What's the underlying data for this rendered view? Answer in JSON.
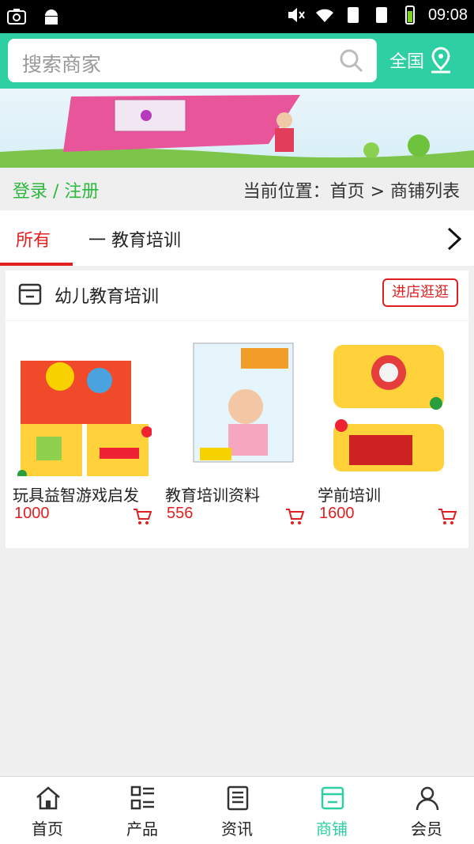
{
  "status_bar": {
    "time": "09:08",
    "icons": [
      "screenshot-icon",
      "android-icon",
      "mute-icon",
      "wifi-icon",
      "sim1-icon",
      "sim2-icon",
      "battery-icon"
    ]
  },
  "search": {
    "placeholder": "搜索商家",
    "region_label": "全国"
  },
  "breadcrumb": {
    "login": "登录 / 注册",
    "path": "当前位置：首页 > 商铺列表"
  },
  "tabs": {
    "active": "所有",
    "category": "一 教育培训"
  },
  "shop": {
    "name": "幼儿教育培训",
    "visit_label": "进店逛逛",
    "products": [
      {
        "name": "玩具益智游戏启发",
        "price": "1000"
      },
      {
        "name": "教育培训资料",
        "price": "556"
      },
      {
        "name": "学前培训",
        "price": "1600"
      }
    ]
  },
  "bottom_nav": [
    {
      "label": "首页",
      "icon": "home-icon"
    },
    {
      "label": "产品",
      "icon": "list-icon"
    },
    {
      "label": "资讯",
      "icon": "news-icon"
    },
    {
      "label": "商铺",
      "icon": "shop-icon",
      "active": true
    },
    {
      "label": "会员",
      "icon": "user-icon"
    }
  ],
  "colors": {
    "accent": "#2ecfa2",
    "price": "#e02020",
    "login": "#2db83f"
  }
}
